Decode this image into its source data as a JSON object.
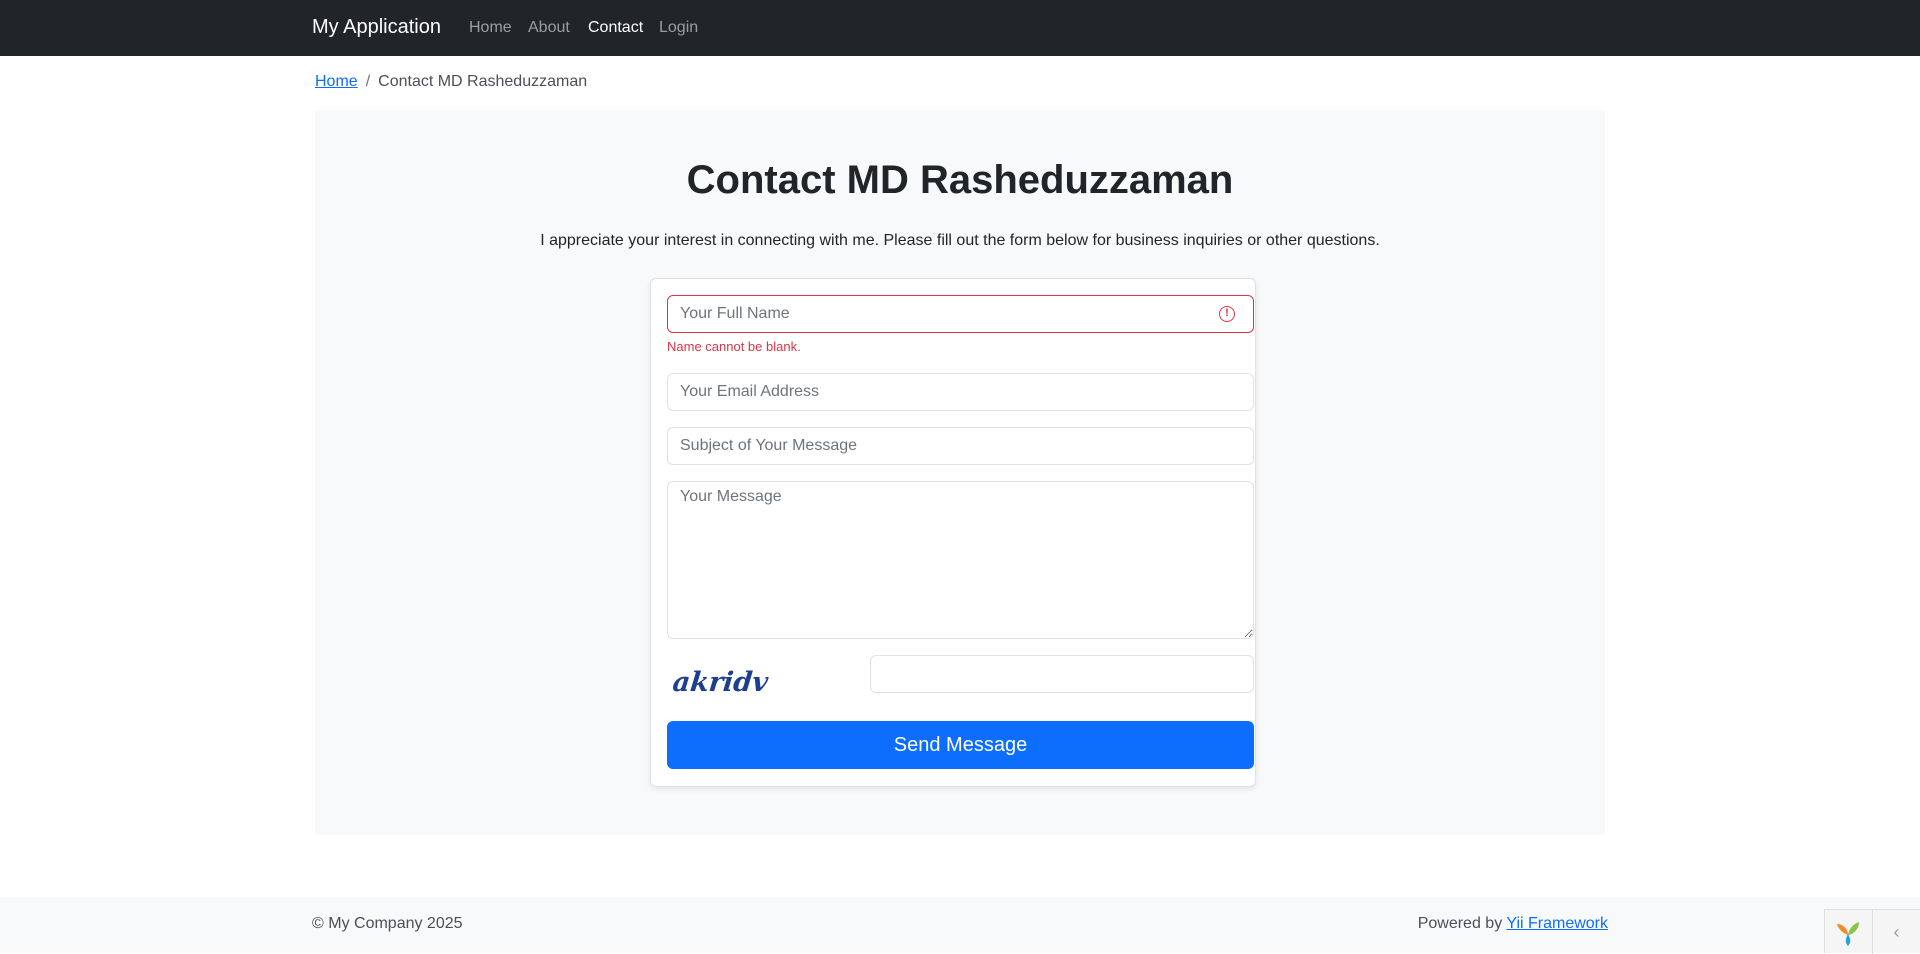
{
  "navbar": {
    "brand": "My Application",
    "items": [
      {
        "label": "Home",
        "active": false
      },
      {
        "label": "About",
        "active": false
      },
      {
        "label": "Contact",
        "active": true
      },
      {
        "label": "Login",
        "active": false
      }
    ]
  },
  "breadcrumb": {
    "home": "Home",
    "separator": "/",
    "current": "Contact MD Rasheduzzaman"
  },
  "page": {
    "title": "Contact MD Rasheduzzaman",
    "lead": "I appreciate your interest in connecting with me. Please fill out the form below for business inquiries or other questions."
  },
  "form": {
    "name": {
      "placeholder": "Your Full Name",
      "value": "",
      "error": "Name cannot be blank."
    },
    "email": {
      "placeholder": "Your Email Address",
      "value": ""
    },
    "subject": {
      "placeholder": "Subject of Your Message",
      "value": ""
    },
    "body": {
      "placeholder": "Your Message",
      "value": ""
    },
    "captcha": {
      "image_text": "akridv",
      "value": ""
    },
    "submit_label": "Send Message"
  },
  "footer": {
    "copyright": "© My Company 2025",
    "powered_prefix": "Powered by",
    "powered_link": "Yii Framework"
  },
  "colors": {
    "navbar_bg": "#212529",
    "primary": "#0d6efd",
    "danger": "#dc3545",
    "panel_bg": "#f8f9fa"
  },
  "icons": {
    "invalid": "exclamation-circle-icon",
    "debug_logo": "yii-logo-icon",
    "toolbar_toggle": "chevron-left-icon"
  }
}
